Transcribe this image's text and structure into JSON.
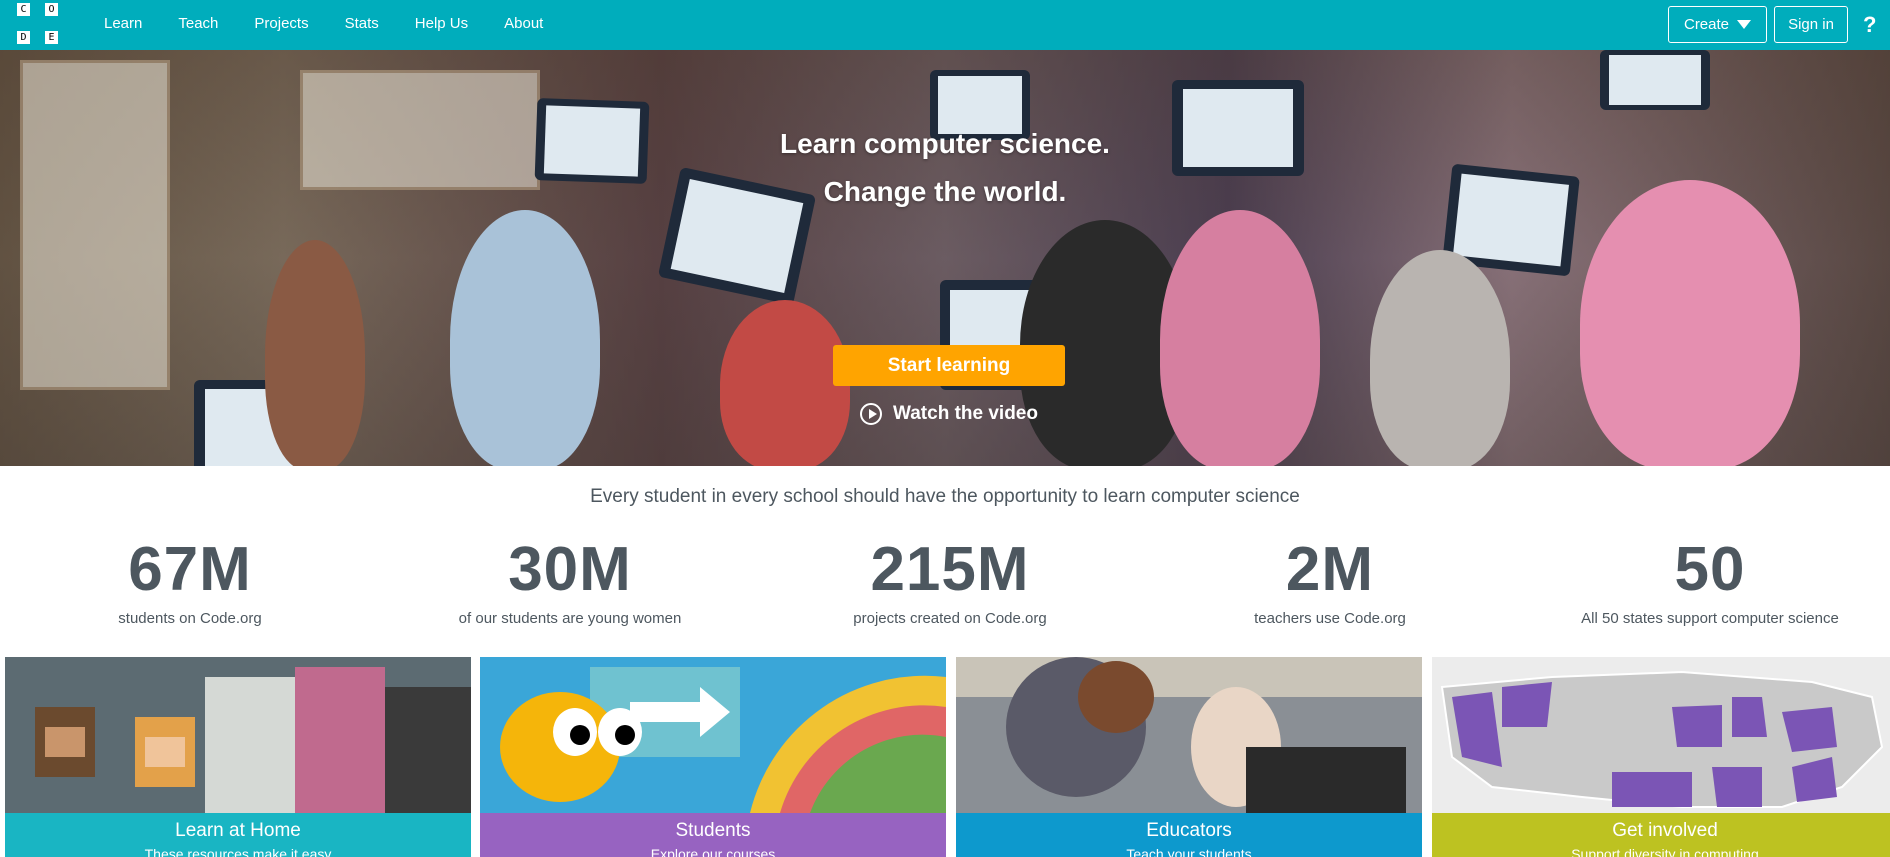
{
  "logo": {
    "letters": [
      "C",
      "O",
      "D",
      "E"
    ]
  },
  "nav": {
    "items": [
      "Learn",
      "Teach",
      "Projects",
      "Stats",
      "Help Us",
      "About"
    ]
  },
  "header": {
    "create_label": "Create",
    "signin_label": "Sign in",
    "help_label": "?"
  },
  "hero": {
    "line1": "Learn computer science.",
    "line2": "Change the world.",
    "start_label": "Start learning",
    "watch_label": "Watch the video"
  },
  "tagline": "Every student in every school should have the opportunity to learn computer science",
  "stats": [
    {
      "value": "67M",
      "label": "students on Code.org"
    },
    {
      "value": "30M",
      "label": "of our students are young women"
    },
    {
      "value": "215M",
      "label": "projects created on Code.org"
    },
    {
      "value": "2M",
      "label": "teachers use Code.org"
    },
    {
      "value": "50",
      "label": "All 50 states support computer science"
    }
  ],
  "cards": [
    {
      "title": "Learn at Home",
      "subtitle": "These resources make it easy",
      "color": "#00adbc"
    },
    {
      "title": "Students",
      "subtitle": "Explore our courses",
      "color": "#8c52ba"
    },
    {
      "title": "Educators",
      "subtitle": "Teach your students",
      "color": "#0094ca"
    },
    {
      "title": "Get involved",
      "subtitle": "Support diversity in computing",
      "color": "#b9bf15"
    }
  ],
  "colors": {
    "brand": "#00adbc",
    "cta": "#ffa400",
    "text": "#4d575f"
  }
}
